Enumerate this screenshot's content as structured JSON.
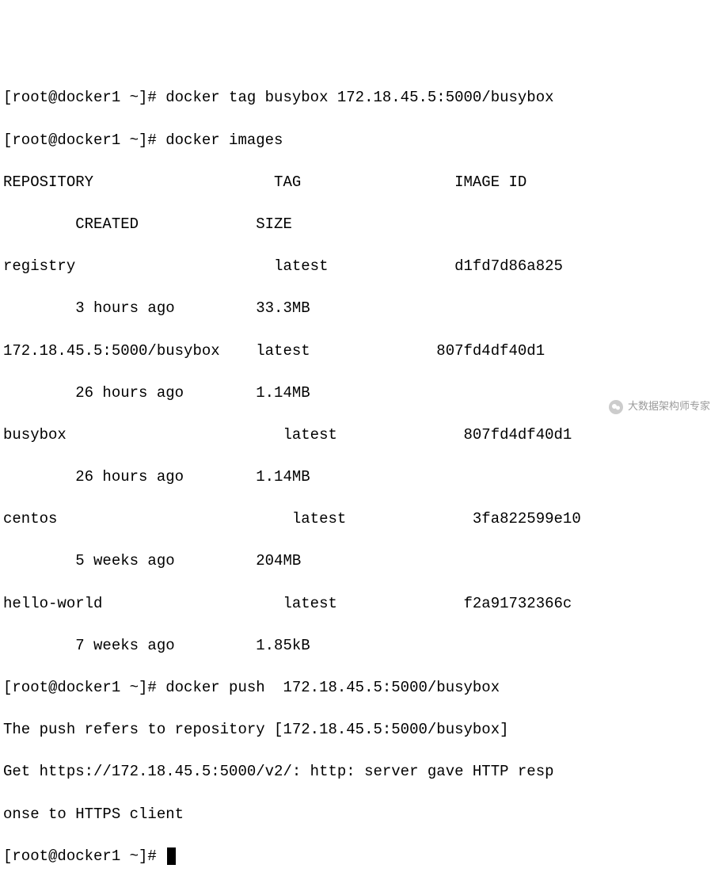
{
  "lines": {
    "l0": "[root@docker1 ~]# docker tag busybox 172.18.45.5:5000/busybox",
    "l1": "[root@docker1 ~]# docker images",
    "l2": "REPOSITORY                    TAG                 IMAGE ID    ",
    "l3": "        CREATED             SIZE",
    "l4": "registry                      latest              d1fd7d86a825",
    "l5": "        3 hours ago         33.3MB",
    "l6": "172.18.45.5:5000/busybox    latest              807fd4df40d1",
    "l7": "        26 hours ago        1.14MB",
    "l8": "busybox                        latest              807fd4df40d1",
    "l9": "        26 hours ago        1.14MB",
    "l10": "centos                          latest              3fa822599e10",
    "l11": "        5 weeks ago         204MB",
    "l12": "hello-world                    latest              f2a91732366c",
    "l13": "        7 weeks ago         1.85kB",
    "l14": "[root@docker1 ~]# docker push  172.18.45.5:5000/busybox",
    "l15": "The push refers to repository [172.18.45.5:5000/busybox]",
    "l16": "Get https://172.18.45.5:5000/v2/: http: server gave HTTP resp",
    "l17": "onse to HTTPS client",
    "l18": "[root@docker1 ~]# "
  },
  "docker_images": [
    {
      "repository": "registry",
      "tag": "latest",
      "image_id": "d1fd7d86a825",
      "created": "3 hours ago",
      "size": "33.3MB"
    },
    {
      "repository": "172.18.45.5:5000/busybox",
      "tag": "latest",
      "image_id": "807fd4df40d1",
      "created": "26 hours ago",
      "size": "1.14MB"
    },
    {
      "repository": "busybox",
      "tag": "latest",
      "image_id": "807fd4df40d1",
      "created": "26 hours ago",
      "size": "1.14MB"
    },
    {
      "repository": "centos",
      "tag": "latest",
      "image_id": "3fa822599e10",
      "created": "5 weeks ago",
      "size": "204MB"
    },
    {
      "repository": "hello-world",
      "tag": "latest",
      "image_id": "f2a91732366c",
      "created": "7 weeks ago",
      "size": "1.85kB"
    }
  ],
  "commands": {
    "tag": "docker tag busybox 172.18.45.5:5000/busybox",
    "images": "docker images",
    "push": "docker push  172.18.45.5:5000/busybox"
  },
  "prompt": "[root@docker1 ~]#",
  "watermark": {
    "text": "大数据架构师专家"
  }
}
